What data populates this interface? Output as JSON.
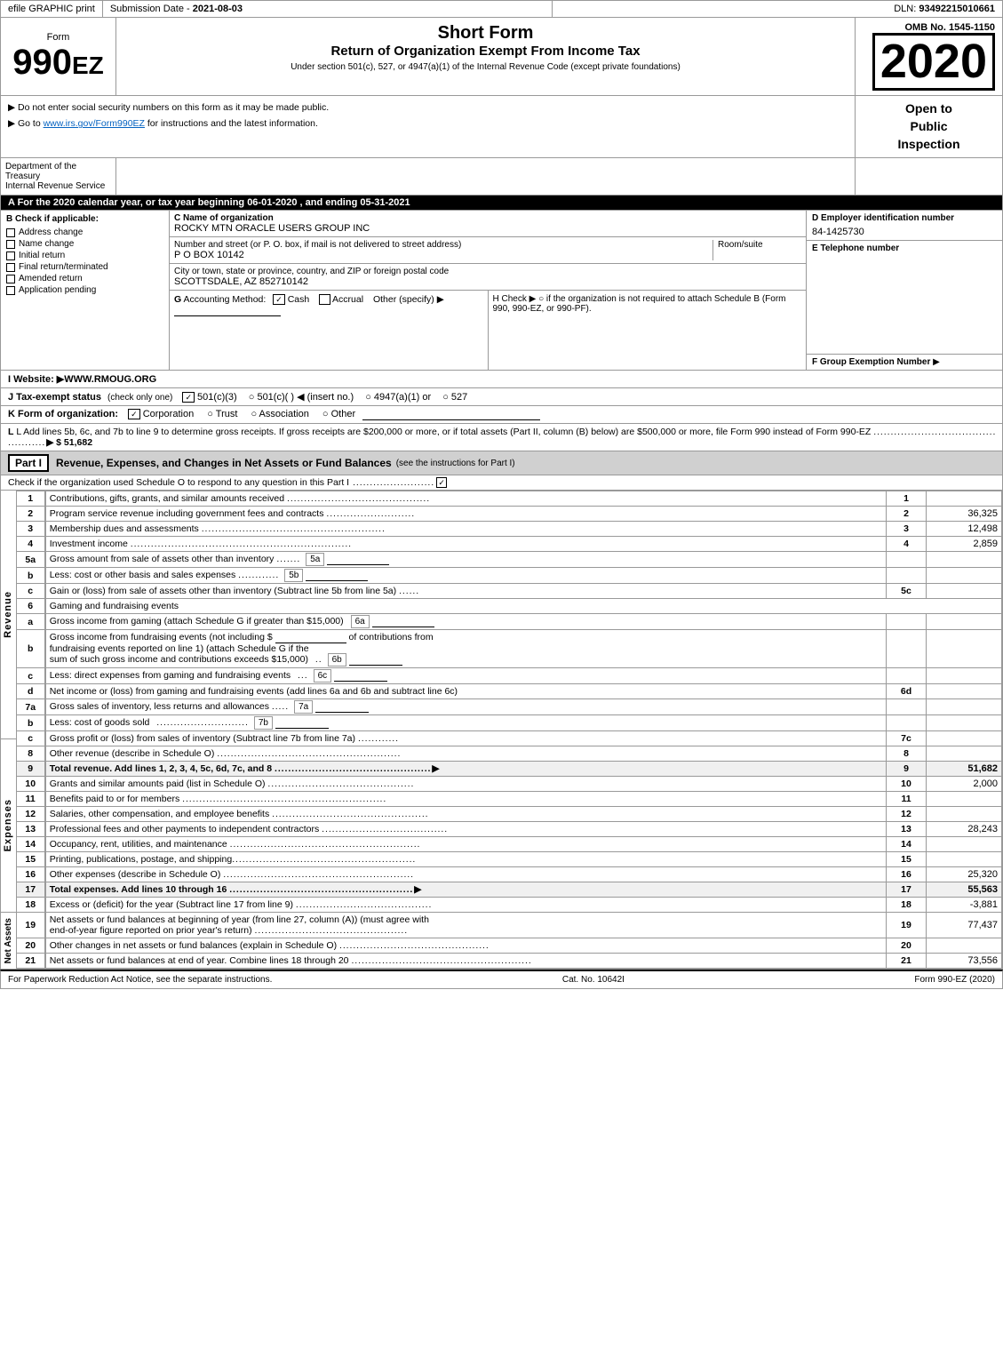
{
  "header": {
    "efile": "efile GRAPHIC print",
    "submission_date_label": "Submission Date -",
    "submission_date": "2021-08-03",
    "dln_label": "DLN:",
    "dln": "93492215010661",
    "omb_label": "OMB No. 1545-1150",
    "form_number": "990EZ",
    "short_form": "Short Form",
    "return_title": "Return of Organization Exempt From Income Tax",
    "under_section": "Under section 501(c), 527, or 4947(a)(1) of the Internal Revenue Code (except private foundations)",
    "year": "2020",
    "instruction1": "▶ Do not enter social security numbers on this form as it may be made public.",
    "instruction2": "▶ Go to www.irs.gov/Form990EZ for instructions and the latest information.",
    "open_to_public": "Open to\nPublic\nInspection"
  },
  "dept": {
    "name": "Department of the Treasury",
    "irs": "Internal Revenue Service"
  },
  "section_a": {
    "label": "A  For the 2020 calendar year, or tax year beginning 06-01-2020 , and ending 05-31-2021"
  },
  "section_b": {
    "label": "B  Check if applicable:",
    "address_change": "Address change",
    "name_change": "Name change",
    "initial_return": "Initial return",
    "final_return": "Final return/terminated",
    "amended_return": "Amended return",
    "application_pending": "Application pending"
  },
  "section_c": {
    "label": "C Name of organization",
    "org_name": "ROCKY MTN ORACLE USERS GROUP INC"
  },
  "section_d": {
    "label": "D Employer identification number",
    "ein": "84-1425730"
  },
  "section_e": {
    "label": "E Telephone number"
  },
  "address": {
    "label": "Number and street (or P. O. box, if mail is not delivered to street address)",
    "street": "P O BOX 10142",
    "room_label": "Room/suite",
    "city_label": "City or town, state or province, country, and ZIP or foreign postal code",
    "city": "SCOTTSDALE, AZ  852710142"
  },
  "section_f": {
    "label": "F Group Exemption Number",
    "arrow": "▶"
  },
  "section_g": {
    "label": "G Accounting Method:",
    "cash_checked": true,
    "cash_label": "Cash",
    "accrual_label": "Accrual",
    "other_label": "Other (specify) ▶"
  },
  "section_h": {
    "label": "H  Check ▶  ○ if the organization is not required to attach Schedule B (Form 990, 990-EZ, or 990-PF)."
  },
  "section_i": {
    "label": "I Website: ▶WWW.RMOUG.ORG"
  },
  "section_j": {
    "label": "J Tax-exempt status",
    "note": "(check only one)",
    "options": "☑ 501(c)(3) ○ 501(c)(  ) ◀ (insert no.) ○ 4947(a)(1) or ○ 527"
  },
  "section_k": {
    "label": "K Form of organization:",
    "corporation": "☑ Corporation",
    "trust": "○ Trust",
    "association": "○ Association",
    "other": "○ Other"
  },
  "section_l": {
    "text": "L Add lines 5b, 6c, and 7b to line 9 to determine gross receipts. If gross receipts are $200,000 or more, or if total assets (Part II, column (B) below) are $500,000 or more, file Form 990 instead of Form 990-EZ",
    "dots": ". . . . . . . . . . . . . . . . . . . . . . . . . . . . . . . . . . . . . . . . . . . . . . . .",
    "arrow": "▶",
    "value": "$ 51,682"
  },
  "part1": {
    "title": "Part I",
    "description": "Revenue, Expenses, and Changes in Net Assets or Fund Balances",
    "see_instructions": "(see the instructions for Part I)",
    "check_schedule_o": "Check if the organization used Schedule O to respond to any question in this Part I",
    "dots": ". . . . . . . . . . . . . . . . . . . . . . .",
    "checkbox": "☑"
  },
  "revenue_rows": [
    {
      "num": "1",
      "desc": "Contributions, gifts, grants, and similar amounts received",
      "dots": ". . . . . . . . . . . . . . . . . . . . . . . . . . . . . . . . . . . . . . . . . .",
      "line": "1",
      "value": ""
    },
    {
      "num": "2",
      "desc": "Program service revenue including government fees and contracts",
      "dots": ". . . . . . . . . . . . . . . . . . . . . . . . . .",
      "line": "2",
      "value": "36,325"
    },
    {
      "num": "3",
      "desc": "Membership dues and assessments",
      "dots": ". . . . . . . . . . . . . . . . . . . . . . . . . . . . . . . . . . . . . . . . . . . . . . . . . . . . . .",
      "line": "3",
      "value": "12,498"
    },
    {
      "num": "4",
      "desc": "Investment income",
      "dots": ". . . . . . . . . . . . . . . . . . . . . . . . . . . . . . . . . . . . . . . . . . . . . . . . . . . . . . . . . . . . . . . . .",
      "line": "4",
      "value": "2,859"
    }
  ],
  "revenue_5a": {
    "num": "5a",
    "desc": "Gross amount from sale of assets other than inventory",
    "dots": ". . . . . . .",
    "sub_label": "5a",
    "line": "",
    "value": ""
  },
  "revenue_5b": {
    "num": "b",
    "desc": "Less: cost or other basis and sales expenses",
    "dots": ". . . . . . . . . . . .",
    "sub_label": "5b",
    "line": "",
    "value": ""
  },
  "revenue_5c": {
    "num": "c",
    "desc": "Gain or (loss) from sale of assets other than inventory (Subtract line 5b from line 5a)",
    "dots": ". . . . . .",
    "line": "5c",
    "value": ""
  },
  "revenue_6": {
    "num": "6",
    "desc": "Gaming and fundraising events"
  },
  "revenue_6a": {
    "num": "a",
    "desc": "Gross income from gaming (attach Schedule G if greater than $15,000)",
    "sub_label": "6a",
    "line": "",
    "value": ""
  },
  "revenue_6b": {
    "num": "b",
    "desc": "Gross income from fundraising events (not including $",
    "blank": "________________",
    "desc2": "of contributions from fundraising events reported on line 1) (attach Schedule G if the sum of such gross income and contributions exceeds $15,000)",
    "dots": ". .",
    "sub_label": "6b",
    "line": "",
    "value": ""
  },
  "revenue_6c": {
    "num": "c",
    "desc": "Less: direct expenses from gaming and fundraising events",
    "dots": ". . .",
    "sub_label": "6c",
    "line": "",
    "value": ""
  },
  "revenue_6d": {
    "num": "d",
    "desc": "Net income or (loss) from gaming and fundraising events (add lines 6a and 6b and subtract line 6c)",
    "line": "6d",
    "value": ""
  },
  "revenue_7a": {
    "num": "7a",
    "desc": "Gross sales of inventory, less returns and allowances",
    "dots": ". . . . .",
    "sub_label": "7a",
    "line": "",
    "value": ""
  },
  "revenue_7b": {
    "num": "b",
    "desc": "Less: cost of goods sold",
    "dots": ". . . . . . . . . . . . . . . . . . . . . . . . . . .",
    "sub_label": "7b",
    "line": "",
    "value": ""
  },
  "revenue_7c": {
    "num": "c",
    "desc": "Gross profit or (loss) from sales of inventory (Subtract line 7b from line 7a)",
    "dots": ". . . . . . . . . . . .",
    "line": "7c",
    "value": ""
  },
  "revenue_8": {
    "num": "8",
    "desc": "Other revenue (describe in Schedule O)",
    "dots": ". . . . . . . . . . . . . . . . . . . . . . . . . . . . . . . . . . . . . . . . . . . . . . . . . . . . . .",
    "line": "8",
    "value": ""
  },
  "revenue_9": {
    "num": "9",
    "desc": "Total revenue. Add lines 1, 2, 3, 4, 5c, 6d, 7c, and 8",
    "dots": ". . . . . . . . . . . . . . . . . . . . . . . . . . . . . . . . . . . . . . . . . . . . . .",
    "arrow": "▶",
    "line": "9",
    "value": "51,682"
  },
  "expenses_rows": [
    {
      "num": "10",
      "desc": "Grants and similar amounts paid (list in Schedule O)",
      "dots": ". . . . . . . . . . . . . . . . . . . . . . . . . . . . . . . . . . . . . . . . . . .",
      "line": "10",
      "value": "2,000"
    },
    {
      "num": "11",
      "desc": "Benefits paid to or for members",
      "dots": ". . . . . . . . . . . . . . . . . . . . . . . . . . . . . . . . . . . . . . . . . . . . . . . . . . . . . . . . . . . .",
      "line": "11",
      "value": ""
    },
    {
      "num": "12",
      "desc": "Salaries, other compensation, and employee benefits",
      "dots": ". . . . . . . . . . . . . . . . . . . . . . . . . . . . . . . . . . . . . . . . . . . . . .",
      "line": "12",
      "value": ""
    },
    {
      "num": "13",
      "desc": "Professional fees and other payments to independent contractors",
      "dots": ". . . . . . . . . . . . . . . . . . . . . . . . . . . . . . . . . . . . .",
      "line": "13",
      "value": "28,243"
    },
    {
      "num": "14",
      "desc": "Occupancy, rent, utilities, and maintenance",
      "dots": ". . . . . . . . . . . . . . . . . . . . . . . . . . . . . . . . . . . . . . . . . . . . . . . . . . . . . . . .",
      "line": "14",
      "value": ""
    },
    {
      "num": "15",
      "desc": "Printing, publications, postage, and shipping",
      "dots": ". . . . . . . . . . . . . . . . . . . . . . . . . . . . . . . . . . . . . . . . . . . . . . . . . . . . . .",
      "line": "15",
      "value": ""
    },
    {
      "num": "16",
      "desc": "Other expenses (describe in Schedule O)",
      "dots": ". . . . . . . . . . . . . . . . . . . . . . . . . . . . . . . . . . . . . . . . . . . . . . . . . . . . . . . .",
      "line": "16",
      "value": "25,320"
    }
  ],
  "expenses_17": {
    "num": "17",
    "desc": "Total expenses. Add lines 10 through 16",
    "dots": ". . . . . . . . . . . . . . . . . . . . . . . . . . . . . . . . . . . . . . . . . . . . . . . . . . . . . .",
    "arrow": "▶",
    "line": "17",
    "value": "55,563"
  },
  "net_assets_rows": [
    {
      "num": "18",
      "desc": "Excess or (deficit) for the year (Subtract line 17 from line 9)",
      "dots": ". . . . . . . . . . . . . . . . . . . . . . . . . . . . . . . . . . . . . . .",
      "line": "18",
      "value": "-3,881"
    },
    {
      "num": "19",
      "desc": "Net assets or fund balances at beginning of year (from line 27, column (A)) (must agree with end-of-year figure reported on prior year's return)",
      "dots": ". . . . . . . . . . . . . . . . . . . . . . . . . . . . . . . . . . . . . . . . . . . . . .",
      "line": "19",
      "value": "77,437"
    },
    {
      "num": "20",
      "desc": "Other changes in net assets or fund balances (explain in Schedule O)",
      "dots": ". . . . . . . . . . . . . . . . . . . . . . . . . . . . . . . . . . . . . . . . . . . . .",
      "line": "20",
      "value": ""
    },
    {
      "num": "21",
      "desc": "Net assets or fund balances at end of year. Combine lines 18 through 20",
      "dots": ". . . . . . . . . . . . . . . . . . . . . . . . . . . . . . . . . . . . . . . . . . . . . . . . . . . . .",
      "line": "21",
      "value": "73,556"
    }
  ],
  "footer": {
    "paperwork": "For Paperwork Reduction Act Notice, see the separate instructions.",
    "cat_no": "Cat. No. 10642I",
    "form_ref": "Form 990-EZ (2020)"
  }
}
